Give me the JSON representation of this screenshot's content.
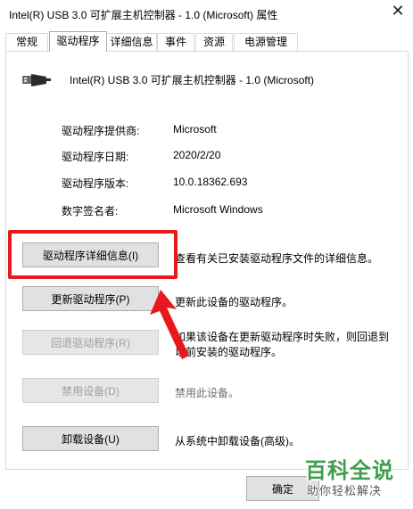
{
  "window": {
    "title": "Intel(R) USB 3.0 可扩展主机控制器 - 1.0 (Microsoft) 属性",
    "close_glyph": "✕"
  },
  "tabs": [
    {
      "label": "常规"
    },
    {
      "label": "驱动程序",
      "active": true
    },
    {
      "label": "详细信息"
    },
    {
      "label": "事件"
    },
    {
      "label": "资源"
    },
    {
      "label": "电源管理"
    }
  ],
  "device": {
    "name": "Intel(R) USB 3.0 可扩展主机控制器 - 1.0 (Microsoft)",
    "icon": "usb-plug-icon"
  },
  "details": [
    {
      "label": "驱动程序提供商:",
      "value": "Microsoft"
    },
    {
      "label": "驱动程序日期:",
      "value": "2020/2/20"
    },
    {
      "label": "驱动程序版本:",
      "value": "10.0.18362.693"
    },
    {
      "label": "数字签名者:",
      "value": "Microsoft Windows"
    }
  ],
  "actions": [
    {
      "button": "驱动程序详细信息(I)",
      "desc1": "查看有关已安装驱动程序文件的详细信息。",
      "enabled": true,
      "highlighted": true
    },
    {
      "button": "更新驱动程序(P)",
      "desc1": "更新此设备的驱动程序。",
      "enabled": true
    },
    {
      "button": "回退驱动程序(R)",
      "desc1": "如果该设备在更新驱动程序时失败，则回退到",
      "desc2": "以前安装的驱动程序。",
      "enabled": false
    },
    {
      "button": "禁用设备(D)",
      "desc1": "禁用此设备。",
      "enabled": false
    },
    {
      "button": "卸载设备(U)",
      "desc1": "从系统中卸载设备(高级)。",
      "enabled": true
    }
  ],
  "footer": {
    "ok_label": "确定"
  },
  "watermark": {
    "main": "百科全说",
    "sub": "助你轻松解决"
  },
  "colors": {
    "highlight": "#e8181f",
    "watermark": "#3f9e4a"
  }
}
